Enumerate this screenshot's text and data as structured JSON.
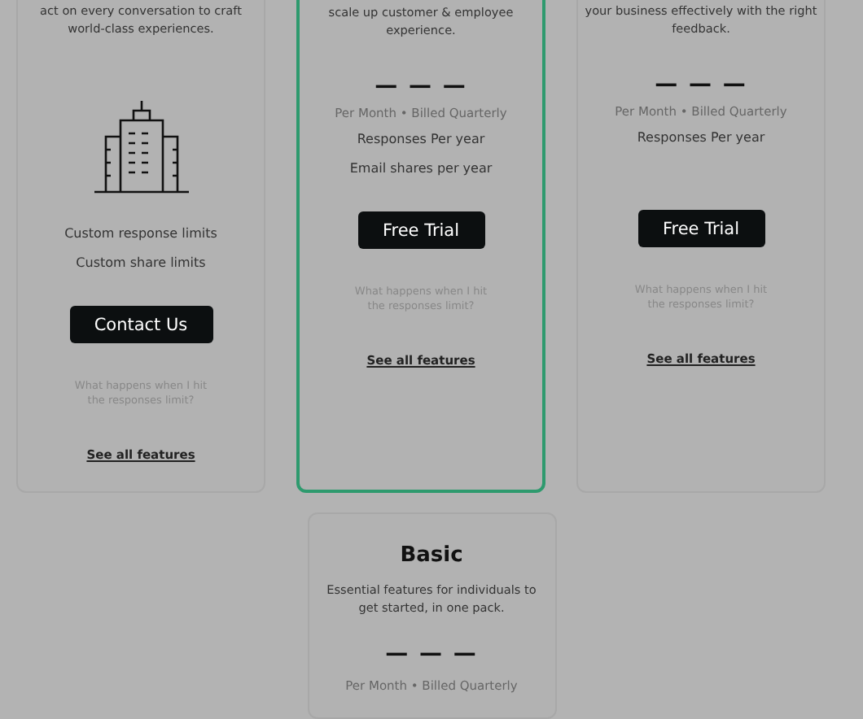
{
  "plans": [
    {
      "description": "act on every conversation to craft world-class experiences.",
      "highlighted": false,
      "kind": "icon",
      "features": [
        "Custom response limits",
        "Custom share limits"
      ],
      "button": "Contact Us",
      "note": "What happens when I hit the responses limit?",
      "link": "See all features"
    },
    {
      "description": "scale up customer & employee experience.",
      "highlighted": true,
      "kind": "price",
      "price": "— — —",
      "period": "Per Month • Billed Quarterly",
      "features": [
        "Responses Per year",
        "Email shares per year"
      ],
      "button": "Free Trial",
      "note": "What happens when I hit the responses limit?",
      "link": "See all features"
    },
    {
      "description": "your business effectively with the right feedback.",
      "highlighted": false,
      "kind": "price",
      "price": "— — —",
      "period": "Per Month • Billed Quarterly",
      "features": [
        "Responses Per year"
      ],
      "button": "Free Trial",
      "note": "What happens when I hit the responses limit?",
      "link": "See all features"
    }
  ],
  "basic": {
    "title": "Basic",
    "description": "Essential features for individuals to get started, in one pack.",
    "price": "— — —",
    "period": "Per Month • Billed Quarterly"
  }
}
